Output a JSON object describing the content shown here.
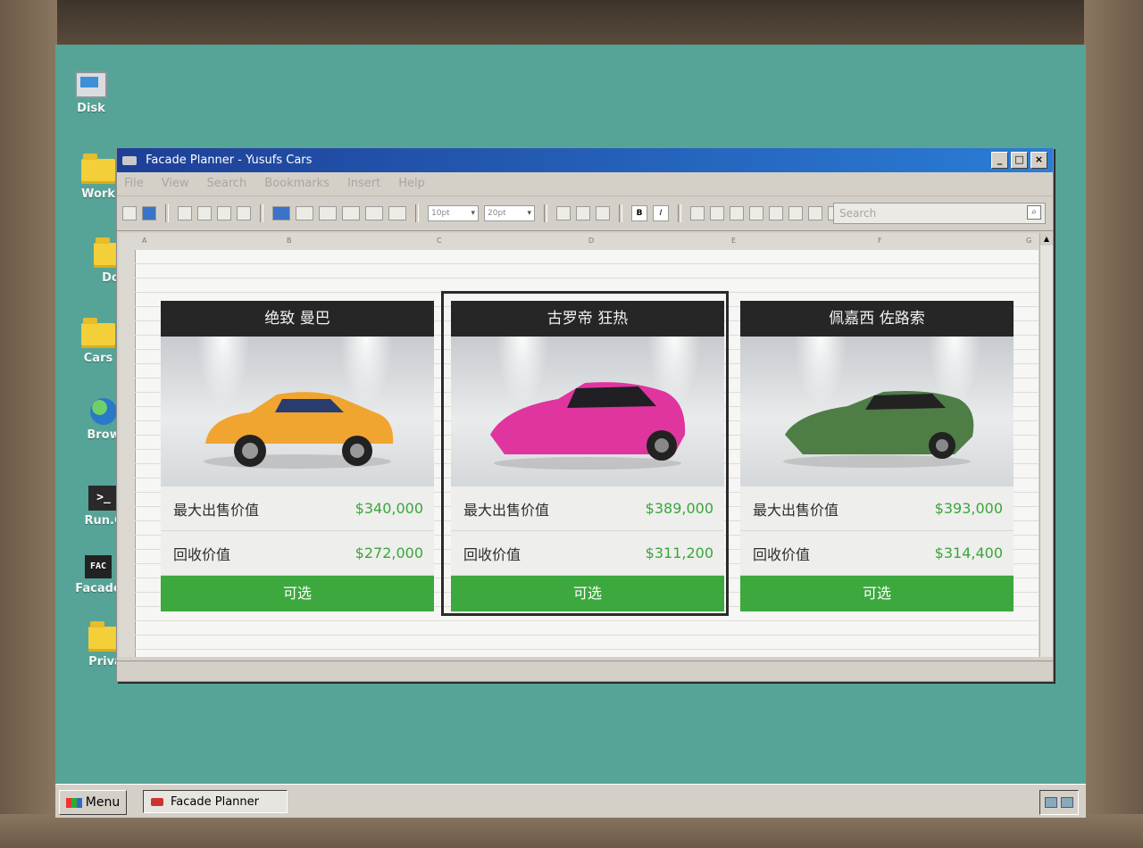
{
  "desktop": {
    "icons": [
      {
        "label": "Disk",
        "icon": "computer-icon"
      },
      {
        "label": "Work",
        "icon": "folder-icon"
      },
      {
        "label": "Do",
        "icon": "folder-icon"
      },
      {
        "label": "Cars",
        "icon": "folder-icon"
      },
      {
        "label": "Brow",
        "icon": "globe-icon"
      },
      {
        "label": "Run.C",
        "icon": "terminal-icon"
      },
      {
        "label": "Facade",
        "icon": "facade-icon"
      },
      {
        "label": "Priva",
        "icon": "folder-icon"
      }
    ]
  },
  "window": {
    "title": "Facade Planner - Yusufs Cars",
    "menu": [
      "File",
      "View",
      "Search",
      "Bookmarks",
      "Insert",
      "Help"
    ],
    "search_placeholder": "Search",
    "font_size_1": "10pt",
    "font_size_2": "20pt",
    "bold": "B",
    "italic": "I",
    "columns": [
      "A",
      "B",
      "C",
      "D",
      "E",
      "F",
      "G"
    ]
  },
  "cards": [
    {
      "name": "绝致 曼巴",
      "max_label": "最大出售价值",
      "max_value": "$340,000",
      "recycle_label": "回收价值",
      "recycle_value": "$272,000",
      "button": "可选",
      "color": "#f0a530"
    },
    {
      "name": "古罗帝 狂热",
      "max_label": "最大出售价值",
      "max_value": "$389,000",
      "recycle_label": "回收价值",
      "recycle_value": "$311,200",
      "button": "可选",
      "color": "#e0359e"
    },
    {
      "name": "佩嘉西 佐路索",
      "max_label": "最大出售价值",
      "max_value": "$393,000",
      "recycle_label": "回收价值",
      "recycle_value": "$314,400",
      "button": "可选",
      "color": "#4f7d46"
    }
  ],
  "taskbar": {
    "menu_label": "Menu",
    "task_label": "Facade Planner"
  },
  "colors": {
    "accent_green": "#3ca83d",
    "title_blue": "#2a7dd6",
    "desktop": "#56a497"
  }
}
